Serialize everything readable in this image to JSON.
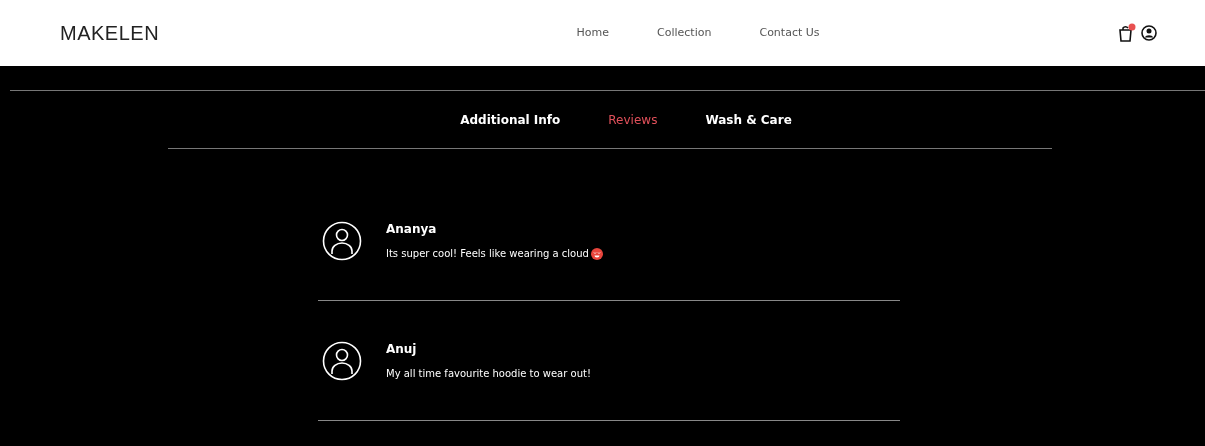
{
  "brand": "MAKELEN",
  "nav": [
    {
      "label": "Home"
    },
    {
      "label": "Collection"
    },
    {
      "label": "Contact Us"
    }
  ],
  "tabs": [
    {
      "label": "Additional Info",
      "selected": false
    },
    {
      "label": "Reviews",
      "selected": true
    },
    {
      "label": "Wash & Care",
      "selected": false
    }
  ],
  "reviews": [
    {
      "name": "Ananya",
      "text": "Its super cool! Feels like wearing a cloud",
      "emoji": true
    },
    {
      "name": "Anuj",
      "text": "My all time favourite hoodie to wear out!",
      "emoji": false
    }
  ]
}
